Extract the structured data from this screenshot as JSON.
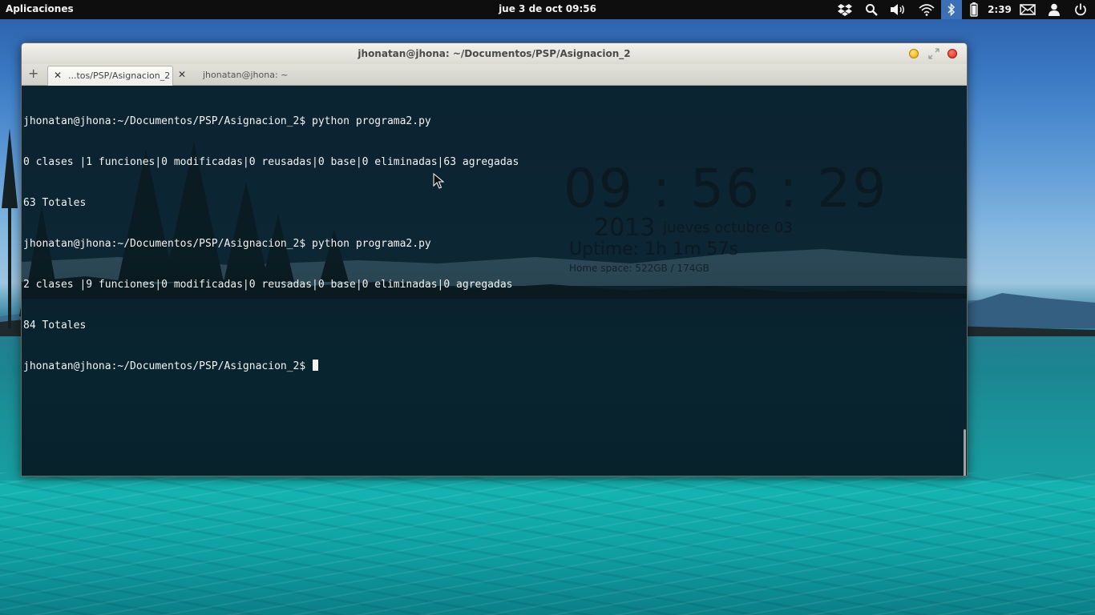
{
  "panel": {
    "apps_label": "Aplicaciones",
    "clock": "jue  3 de oct 09:56",
    "battery_time": "2:39",
    "indicators": [
      "dropbox-icon",
      "search-icon",
      "volume-icon",
      "wifi-icon",
      "bluetooth-icon",
      "battery-icon",
      "mail-icon",
      "user-icon",
      "power-icon"
    ]
  },
  "window": {
    "title": "jhonatan@jhona: ~/Documentos/PSP/Asignacion_2",
    "tabs": [
      {
        "label": "...tos/PSP/Asignacion_2",
        "active": true
      },
      {
        "label": "jhonatan@jhona: ~",
        "active": false
      }
    ],
    "new_tab_label": "+",
    "tab_close_glyph": "✕"
  },
  "terminal": {
    "lines": [
      "jhonatan@jhona:~/Documentos/PSP/Asignacion_2$ python programa2.py",
      "0 clases |1 funciones|0 modificadas|0 reusadas|0 base|0 eliminadas|63 agregadas",
      "63 Totales",
      "jhonatan@jhona:~/Documentos/PSP/Asignacion_2$ python programa2.py",
      "2 clases |9 funciones|0 modificadas|0 reusadas|0 base|0 eliminadas|0 agregadas",
      "84 Totales",
      "jhonatan@jhona:~/Documentos/PSP/Asignacion_2$ "
    ]
  },
  "conky": {
    "time": "09 : 56 : 29",
    "year": "2013",
    "date": "jueves octubre 03",
    "uptime": "Uptime:  1h 1m 57s",
    "home_space": "Home space: 522GB  /  174GB"
  },
  "colors": {
    "panel_bg": "#0e0e0e",
    "bluetooth_active_bg": "#3b6fb6",
    "terminal_text": "#f3f3f3"
  }
}
